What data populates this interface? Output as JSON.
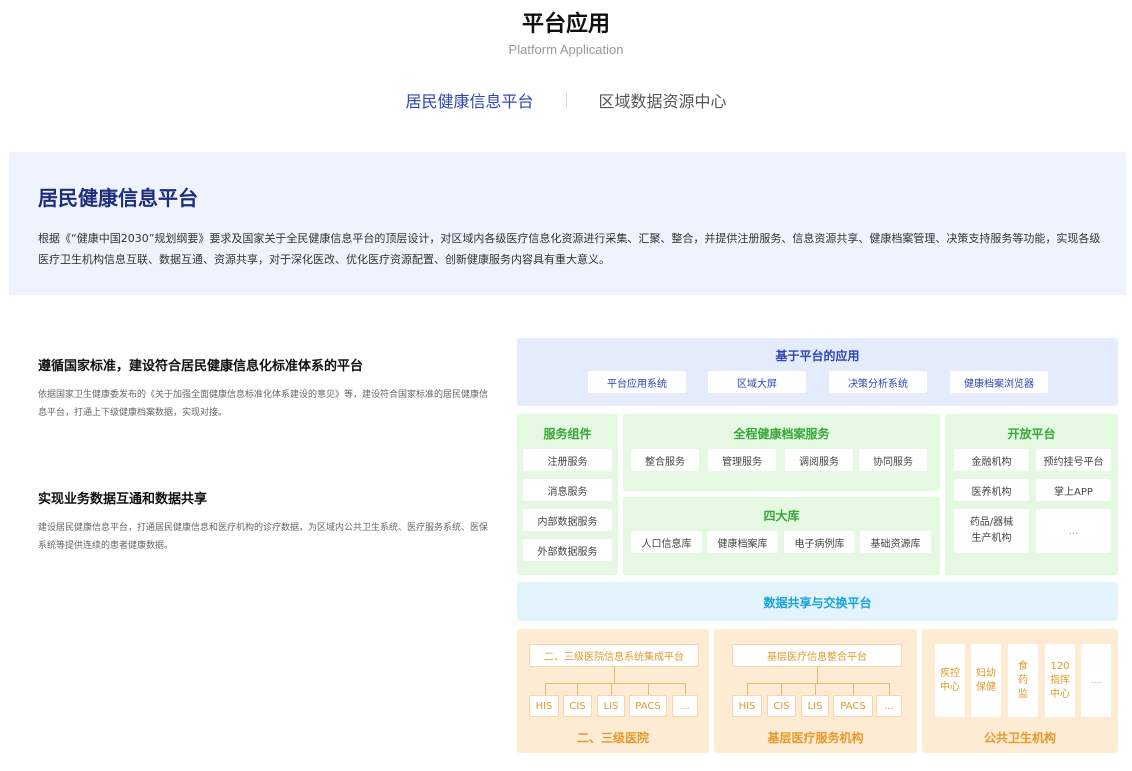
{
  "header": {
    "title": "平台应用",
    "subtitle": "Platform Application"
  },
  "tabs": [
    {
      "label": "居民健康信息平台",
      "active": true
    },
    {
      "label": "区域数据资源中心",
      "active": false
    }
  ],
  "intro": {
    "title": "居民健康信息平台",
    "text": "根据《“健康中国2030”规划纲要》要求及国家关于全民健康信息平台的顶层设计，对区域内各级医疗信息化资源进行采集、汇聚、整合，并提供注册服务、信息资源共享、健康档案管理、决策支持服务等功能，实现各级医疗卫生机构信息互联、数据互通、资源共享，对于深化医改、优化医疗资源配置、创新健康服务内容具有重大意义。"
  },
  "features": [
    {
      "title": "遵循国家标准，建设符合居民健康信息化标准体系的平台",
      "text": "依据国家卫生健康委发布的《关于加强全面健康信息标准化体系建设的意见》等，建设符合国家标准的居民健康信息平台，打通上下级健康档案数据，实现对接。"
    },
    {
      "title": "实现业务数据互通和数据共享",
      "text": "建设居民健康信息平台，打通居民健康信息和医疗机构的诊疗数据，为区域内公共卫生系统、医疗服务系统、医保系统等提供连续的患者健康数据。"
    }
  ],
  "diagram": {
    "apps": {
      "title": "基于平台的应用",
      "items": [
        "平台应用系统",
        "区域大屏",
        "决策分析系统",
        "健康档案浏览器"
      ]
    },
    "service_components": {
      "title": "服务组件",
      "items": [
        "注册服务",
        "消息服务",
        "内部数据服务",
        "外部数据服务"
      ]
    },
    "health_records": {
      "title": "全程健康档案服务",
      "items": [
        "整合服务",
        "管理服务",
        "调阅服务",
        "协同服务"
      ]
    },
    "four_libraries": {
      "title": "四大库",
      "items": [
        "人口信息库",
        "健康档案库",
        "电子病例库",
        "基础资源库"
      ]
    },
    "open_platform": {
      "title": "开放平台",
      "items": [
        "金融机构",
        "预约挂号平台",
        "医养机构",
        "掌上APP",
        "药品/器械生产机构",
        "..."
      ]
    },
    "exchange": {
      "title": "数据共享与交换平台"
    },
    "hospitals": {
      "title": "二、三级医院",
      "platform": "二、三级医院信息系统集成平台",
      "systems": [
        "HIS",
        "CIS",
        "LIS",
        "PACS",
        "..."
      ]
    },
    "primary_care": {
      "title": "基层医疗服务机构",
      "platform": "基层医疗信息整合平台",
      "systems": [
        "HIS",
        "CIS",
        "LIS",
        "PACS",
        "..."
      ]
    },
    "public_health": {
      "title": "公共卫生机构",
      "items": [
        "疾控中心",
        "妇幼保健",
        "食药监",
        "120指挥中心",
        "..."
      ]
    },
    "colors": {
      "blue_bg": "#e4ecfb",
      "green_bg": "#e4f8e2",
      "green_text": "#3aa73a",
      "cyan_bg": "#e2f3fb",
      "cyan_text": "#1aa3d9",
      "orange_bg": "#fdebd3",
      "orange_text": "#e6992c",
      "accent_blue": "#2d47b4"
    }
  }
}
